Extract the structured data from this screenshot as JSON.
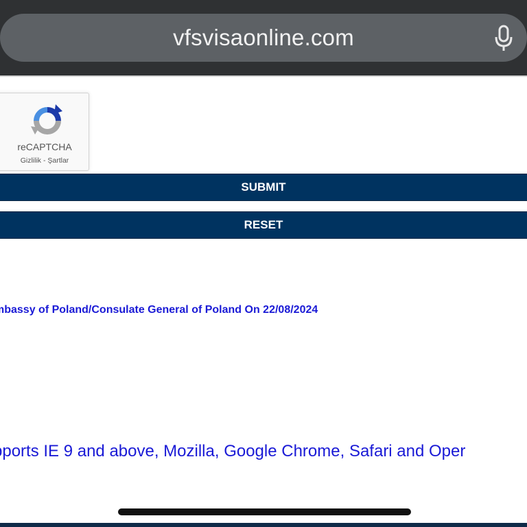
{
  "browser": {
    "url": "vfsvisaonline.com",
    "mic_icon": "microphone-icon"
  },
  "captcha": {
    "title": "reCAPTCHA",
    "links": "Gizlilik - Şartlar",
    "logo_icon": "recaptcha-logo-icon"
  },
  "buttons": {
    "submit": "SUBMIT",
    "reset": "RESET"
  },
  "notice": "mbassy of Poland/Consulate General of Poland On 22/08/2024",
  "browser_support": "pports IE 9 and above, Mozilla, Google Chrome, Safari and Oper",
  "colors": {
    "button_bg": "#003360",
    "link_blue": "#1a1ad6",
    "top_bar": "#2f3133"
  }
}
